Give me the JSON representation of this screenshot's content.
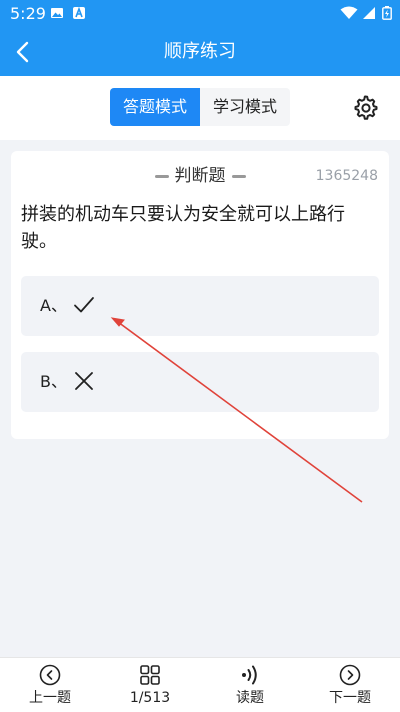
{
  "status_bar": {
    "time": "5:29"
  },
  "header": {
    "title": "顺序练习"
  },
  "modes": {
    "active": "答题模式",
    "inactive": "学习模式"
  },
  "question": {
    "type": "判断题",
    "id": "1365248",
    "text": "拼装的机动车只要认为安全就可以上路行驶。",
    "options": [
      {
        "label": "A、",
        "mark": "check-icon"
      },
      {
        "label": "B、",
        "mark": "cross-icon"
      }
    ]
  },
  "colors": {
    "accent": "#2196f3",
    "active_tab": "#1e88f5",
    "annotation_arrow": "#e0433a"
  },
  "tabbar": {
    "prev": "上一题",
    "progress": "1/513",
    "read": "读题",
    "next": "下一题"
  }
}
